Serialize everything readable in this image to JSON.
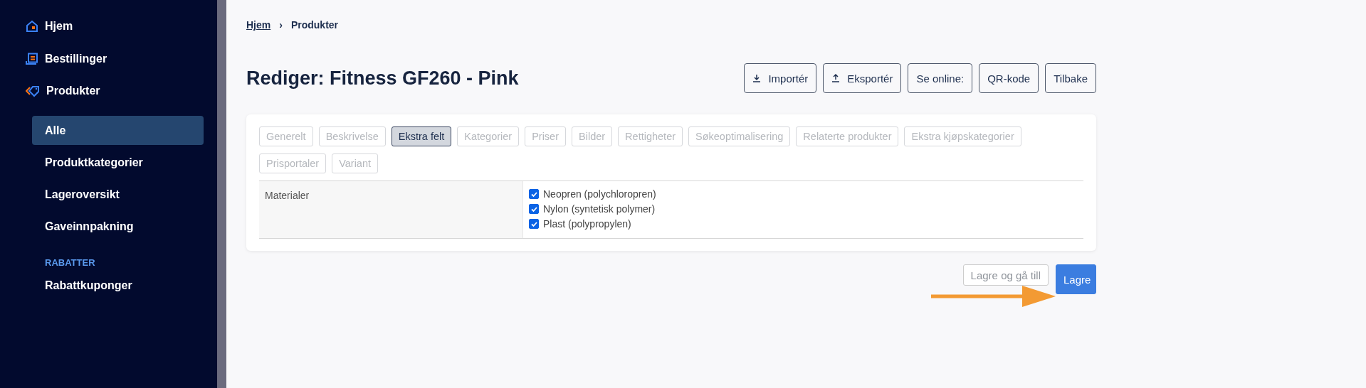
{
  "sidebar": {
    "items": [
      {
        "label": "Hjem",
        "kind": "home",
        "selected": false
      },
      {
        "label": "Bestillinger",
        "kind": "orders",
        "selected": false
      },
      {
        "label": "Produkter",
        "kind": "tag",
        "selected": false,
        "children": [
          {
            "label": "Alle",
            "selected": true
          },
          {
            "label": "Produktkategorier",
            "selected": false
          },
          {
            "label": "Lageroversikt",
            "selected": false
          },
          {
            "label": "Gaveinnpakning",
            "selected": false
          }
        ]
      }
    ],
    "section_title": "RABATTER",
    "section_items": [
      {
        "label": "Rabattkuponger",
        "selected": false
      }
    ]
  },
  "breadcrumb": {
    "link": "Hjem",
    "separator": "›",
    "current": "Produkter"
  },
  "title": "Rediger: Fitness GF260 - Pink",
  "header_buttons": [
    {
      "label": "Importér",
      "kind": "import"
    },
    {
      "label": "Eksportér",
      "kind": "export"
    },
    {
      "label": "Se online:"
    },
    {
      "label": "QR-kode"
    },
    {
      "label": "Tilbake"
    }
  ],
  "tabs": [
    {
      "label": "Generelt",
      "selected": false
    },
    {
      "label": "Beskrivelse",
      "selected": false
    },
    {
      "label": "Ekstra felt",
      "selected": true
    },
    {
      "label": "Kategorier",
      "selected": false
    },
    {
      "label": "Priser",
      "selected": false
    },
    {
      "label": "Bilder",
      "selected": false
    },
    {
      "label": "Rettigheter",
      "selected": false
    },
    {
      "label": "Søkeoptimalisering",
      "selected": false
    },
    {
      "label": "Relaterte produkter",
      "selected": false
    },
    {
      "label": "Ekstra kjøpskategorier",
      "selected": false
    },
    {
      "label": "Prisportaler",
      "selected": false
    },
    {
      "label": "Variant",
      "selected": false
    }
  ],
  "fields": [
    {
      "label": "Materialer",
      "options": [
        {
          "label": "Neopren (polychloropren)",
          "checked": true
        },
        {
          "label": "Nylon (syntetisk polymer)",
          "checked": true
        },
        {
          "label": "Plast (polypropylen)",
          "checked": true
        }
      ]
    }
  ],
  "footer_buttons": [
    {
      "label": "Lagre og gå till",
      "kind": "secondary",
      "disabled": true
    },
    {
      "label": "Lagre",
      "kind": "primary",
      "disabled": false
    }
  ]
}
